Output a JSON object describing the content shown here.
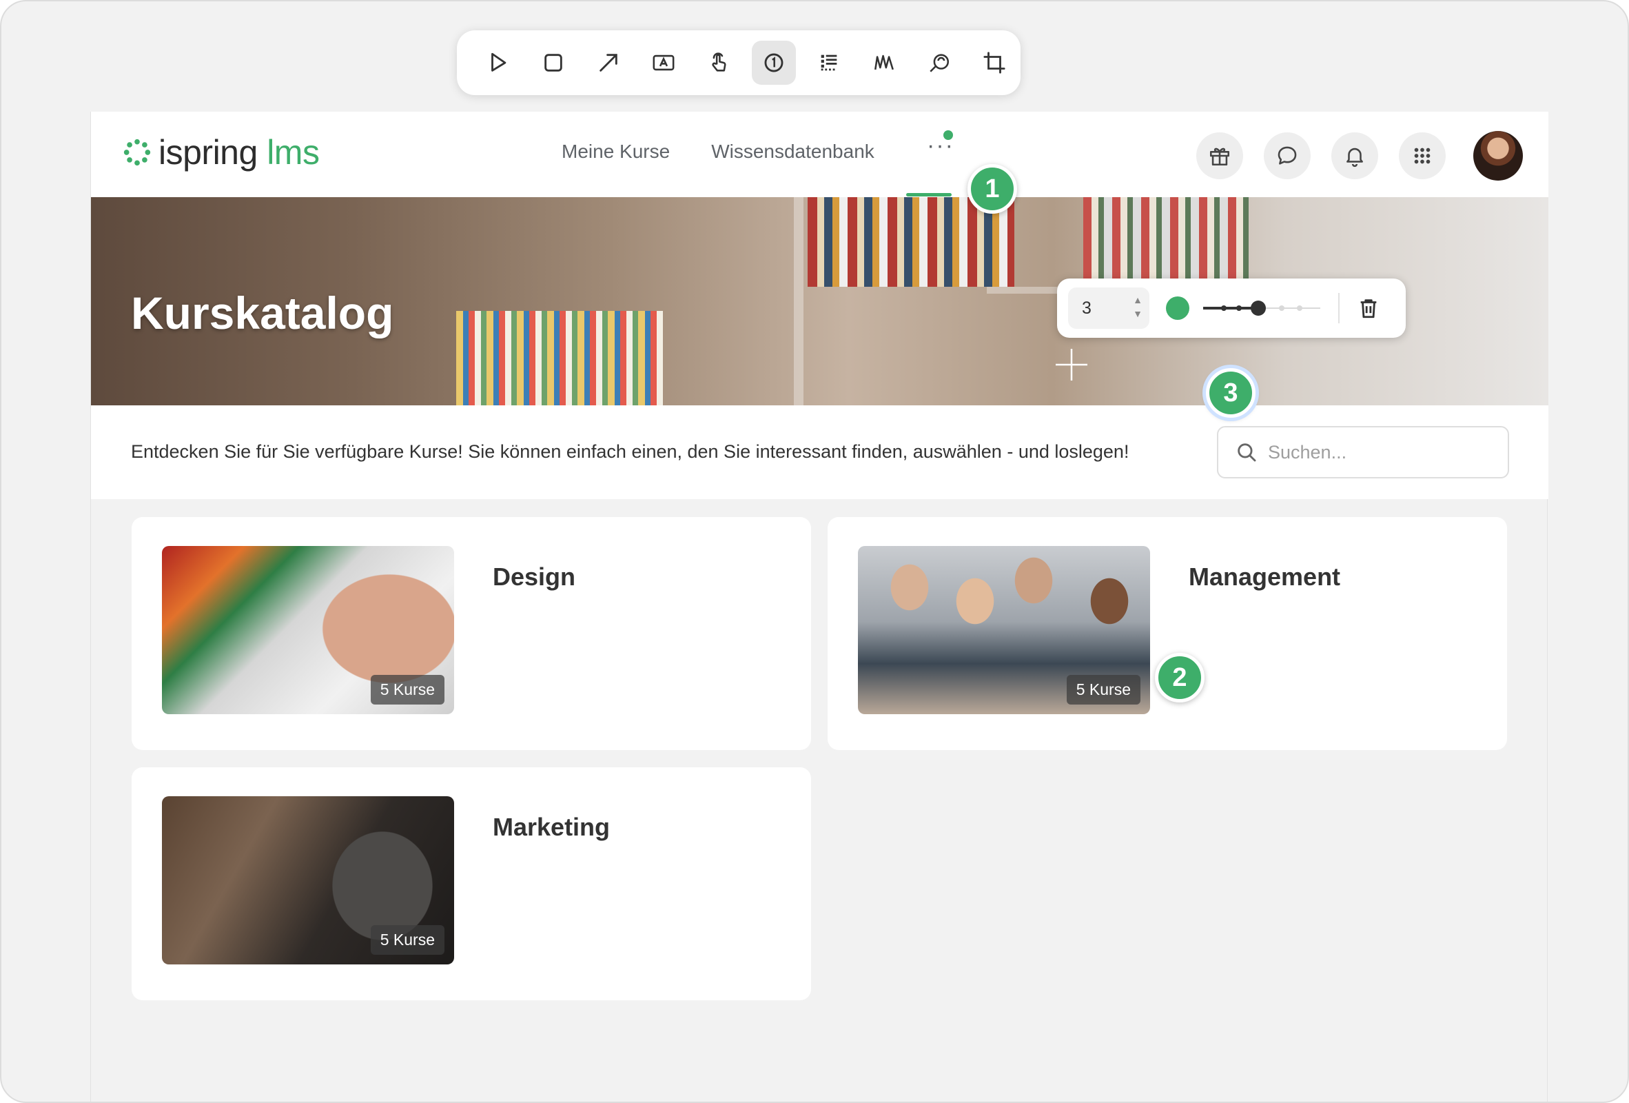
{
  "toolbar": {
    "tools": [
      {
        "name": "select-tool",
        "icon": "cursor-arrow-icon",
        "active": false
      },
      {
        "name": "rectangle-tool",
        "icon": "rectangle-icon",
        "active": false
      },
      {
        "name": "arrow-tool",
        "icon": "arrow-icon",
        "active": false
      },
      {
        "name": "text-tool",
        "icon": "text-box-icon",
        "active": false
      },
      {
        "name": "click-tool",
        "icon": "hand-click-icon",
        "active": false
      },
      {
        "name": "number-tool",
        "icon": "numbered-marker-icon",
        "active": true
      },
      {
        "name": "blur-tool",
        "icon": "blur-grid-icon",
        "active": false
      },
      {
        "name": "highlight-tool",
        "icon": "highlighter-icon",
        "active": false
      },
      {
        "name": "magnify-tool",
        "icon": "magnifier-icon",
        "active": false
      },
      {
        "name": "crop-tool",
        "icon": "crop-icon",
        "active": false
      }
    ]
  },
  "app": {
    "logo": {
      "brand": "ispring",
      "product": "lms",
      "accent": "#3eae6a"
    },
    "nav": {
      "items": [
        "Meine Kurse",
        "Wissensdatenbank"
      ],
      "more": "···"
    },
    "header_icons": [
      "gift-icon",
      "chat-icon",
      "bell-icon",
      "apps-grid-icon"
    ],
    "hero": {
      "title": "Kurskatalog"
    },
    "intro": {
      "text": "Entdecken Sie für Sie verfügbare Kurse! Sie können einfach einen, den Sie interessant finden, auswählen - und loslegen!",
      "search_placeholder": "Suchen..."
    },
    "categories": [
      {
        "title": "Design",
        "badge": "5 Kurse"
      },
      {
        "title": "Management",
        "badge": "5 Kurse"
      },
      {
        "title": "Marketing",
        "badge": "5 Kurse"
      }
    ]
  },
  "annotations": {
    "markers": [
      "1",
      "2",
      "3"
    ],
    "marker_color": "#3eae6a",
    "properties": {
      "number_value": "3",
      "color": "#3eae6a",
      "size_level": "3 of 5"
    }
  }
}
